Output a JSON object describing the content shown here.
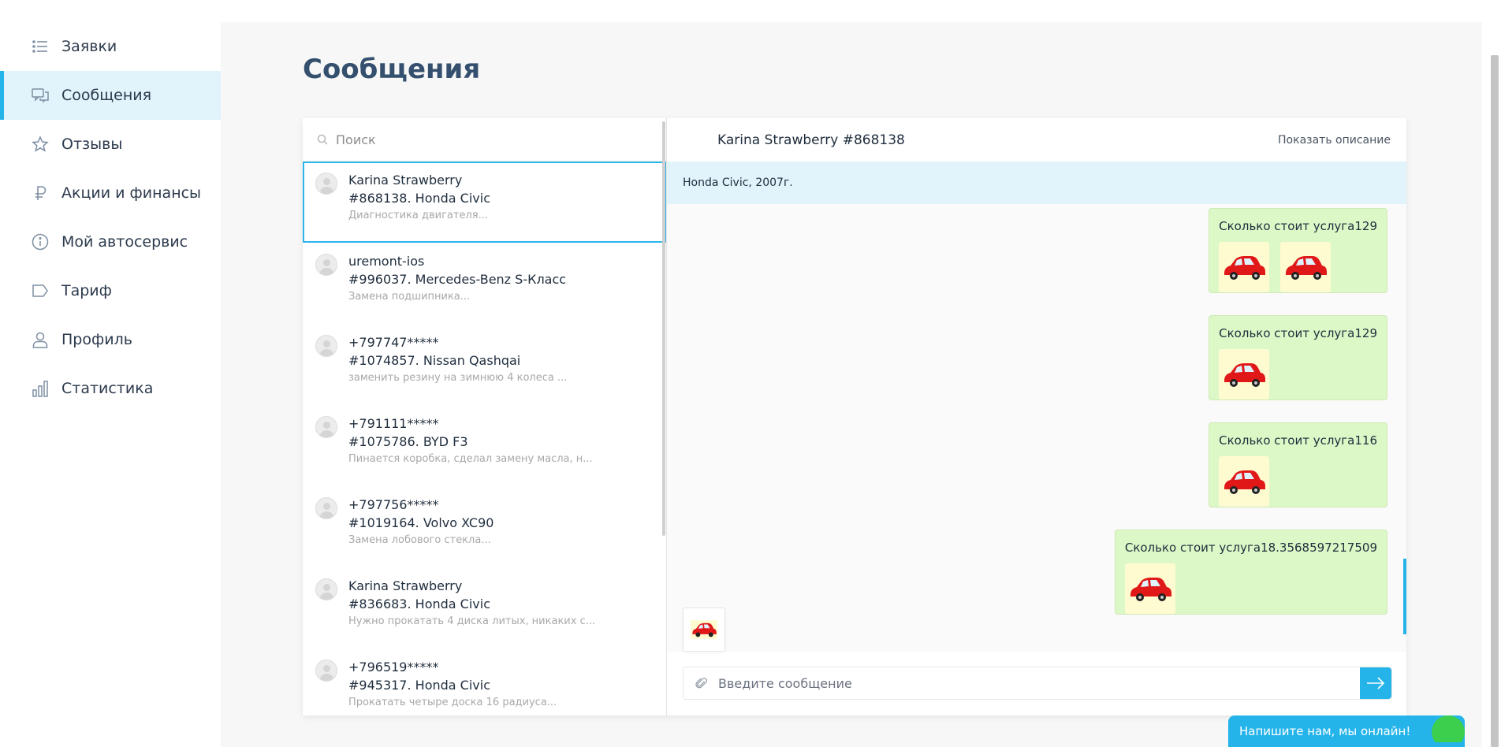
{
  "sidebar": {
    "items": [
      {
        "label": "Заявки",
        "icon": "list-icon",
        "active": false
      },
      {
        "label": "Сообщения",
        "icon": "chat-icon",
        "active": true
      },
      {
        "label": "Отзывы",
        "icon": "star-icon",
        "active": false
      },
      {
        "label": "Акции и финансы",
        "icon": "ruble-icon",
        "active": false
      },
      {
        "label": "Мой автосервис",
        "icon": "info-icon",
        "active": false
      },
      {
        "label": "Тариф",
        "icon": "tag-icon",
        "active": false
      },
      {
        "label": "Профиль",
        "icon": "user-icon",
        "active": false
      },
      {
        "label": "Статистика",
        "icon": "bar-chart-icon",
        "active": false
      }
    ]
  },
  "page": {
    "title": "Сообщения"
  },
  "search": {
    "placeholder": "Поиск"
  },
  "conversations": [
    {
      "name": "Karina Strawberry",
      "title": "#868138. Honda Civic",
      "preview": "Диагностика двигателя...",
      "active": true
    },
    {
      "name": "uremont-ios",
      "title": "#996037. Mercedes-Benz S-Класс",
      "preview": "Замена подшипника...",
      "active": false
    },
    {
      "name": "+797747*****",
      "title": "#1074857. Nissan Qashqai",
      "preview": "заменить резину на зимнюю  4 колеса ...",
      "active": false
    },
    {
      "name": "+791111*****",
      "title": "#1075786. BYD F3",
      "preview": "Пинается коробка, сделал замену масла, н...",
      "active": false
    },
    {
      "name": "+797756*****",
      "title": "#1019164. Volvo XC90",
      "preview": "Замена лобового стекла...",
      "active": false
    },
    {
      "name": "Karina Strawberry",
      "title": "#836683. Honda Civic",
      "preview": "Нужно прокатать 4 диска литых, никаких с...",
      "active": false
    },
    {
      "name": "+796519*****",
      "title": "#945317. Honda Civic",
      "preview": "Прокатать четыре доска 16 радиуса...",
      "active": false
    }
  ],
  "chat": {
    "title": "Karina Strawberry #868138",
    "show_description": "Показать описание",
    "car": "Honda Civic, 2007г.",
    "messages": [
      {
        "text": "Сколько стоит услуга129",
        "images": 2
      },
      {
        "text": "Сколько стоит услуга129",
        "images": 1
      },
      {
        "text": "Сколько стоит услуга116",
        "images": 1
      },
      {
        "text": "Сколько стоит услуга18.3568597217509",
        "images": 1
      }
    ],
    "composer_placeholder": "Введите сообщение"
  },
  "widget": {
    "label": "Напишите нам, мы онлайн!"
  },
  "colors": {
    "accent": "#25b4ea",
    "active_bg": "#e1f3fb",
    "message_bg": "#dcf8c6",
    "title": "#34506e"
  }
}
